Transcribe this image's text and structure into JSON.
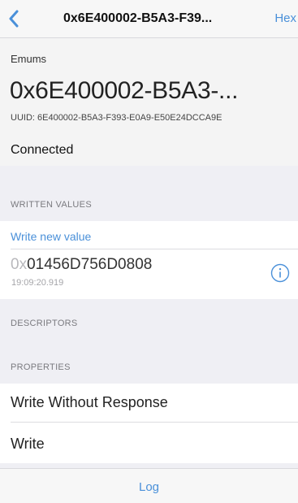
{
  "navbar": {
    "title": "0x6E400002-B5A3-F39...",
    "right_label": "Hex",
    "back_icon": "chevron-left-icon"
  },
  "header": {
    "peripheral_name": "Emums",
    "characteristic_title": "0x6E400002-B5A3-...",
    "uuid_line": "UUID: 6E400002-B5A3-F393-E0A9-E50E24DCCA9E",
    "status": "Connected"
  },
  "written_values": {
    "section_label": "WRITTEN VALUES",
    "write_new_label": "Write new value",
    "entries": [
      {
        "prefix": "0x",
        "value": "01456D756D0808",
        "timestamp": "19:09:20.919",
        "info_icon": "info-circle-icon"
      }
    ]
  },
  "descriptors": {
    "section_label": "DESCRIPTORS"
  },
  "properties": {
    "section_label": "PROPERTIES",
    "items": [
      "Write Without Response",
      "Write"
    ]
  },
  "toolbar": {
    "log_label": "Log"
  },
  "colors": {
    "accent": "#4a90d9",
    "background": "#efeff4",
    "cell": "#ffffff"
  }
}
